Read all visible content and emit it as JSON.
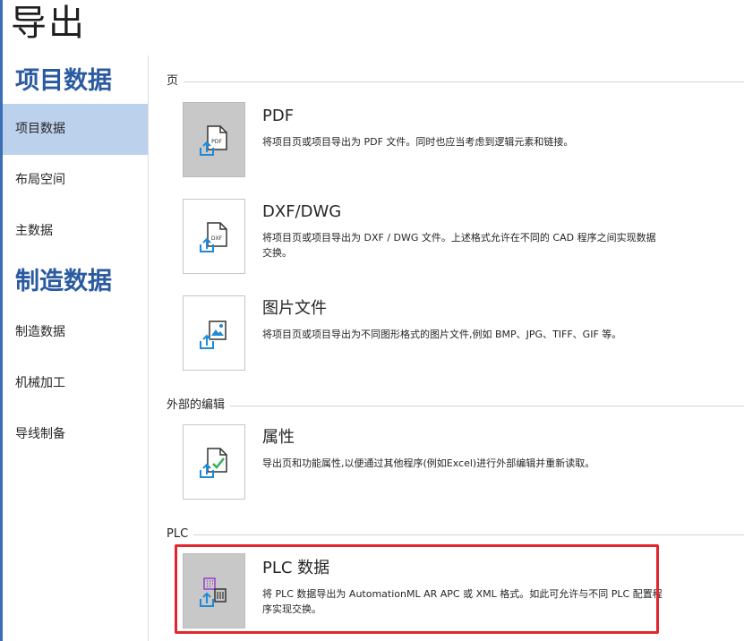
{
  "page": {
    "title": "导出"
  },
  "sidebar": {
    "groups": [
      {
        "heading": "项目数据",
        "items": [
          "项目数据",
          "布局空间",
          "主数据"
        ]
      },
      {
        "heading": "制造数据",
        "items": [
          "制造数据",
          "机械加工",
          "导线制备"
        ]
      }
    ],
    "selected": "项目数据"
  },
  "sections": {
    "page": "页",
    "external": "外部的编辑",
    "plc": "PLC"
  },
  "options": {
    "pdf": {
      "title": "PDF",
      "desc": "将项目页或项目导出为 PDF 文件。同时也应当考虑到逻辑元素和链接。",
      "icon": "pdf-export-icon",
      "icon_label": "PDF"
    },
    "dxf": {
      "title": "DXF/DWG",
      "desc": "将项目页或项目导出为 DXF / DWG 文件。上述格式允许在不同的 CAD 程序之间实现数据交换。",
      "icon": "dxf-export-icon",
      "icon_label": "DXF"
    },
    "image": {
      "title": "图片文件",
      "desc": "将项目页或项目导出为不同图形格式的图片文件,例如 BMP、JPG、TIFF、GIF 等。",
      "icon": "image-export-icon"
    },
    "properties": {
      "title": "属性",
      "desc": "导出页和功能属性,以便通过其他程序(例如Excel)进行外部编辑并重新读取。",
      "icon": "properties-export-icon"
    },
    "plc": {
      "title": "PLC 数据",
      "desc": "将 PLC 数据导出为 AutomationML AR APC 或 XML 格式。如此可允许与不同 PLC 配置程序实现交换。",
      "icon": "plc-export-icon"
    }
  },
  "colors": {
    "accent": "#2a5aa0",
    "selected_bg": "#bcd1ec",
    "highlight": "#e3262d",
    "icon_blue": "#1e8bd6",
    "icon_green": "#35b05a",
    "icon_purple": "#9b3fc9"
  }
}
